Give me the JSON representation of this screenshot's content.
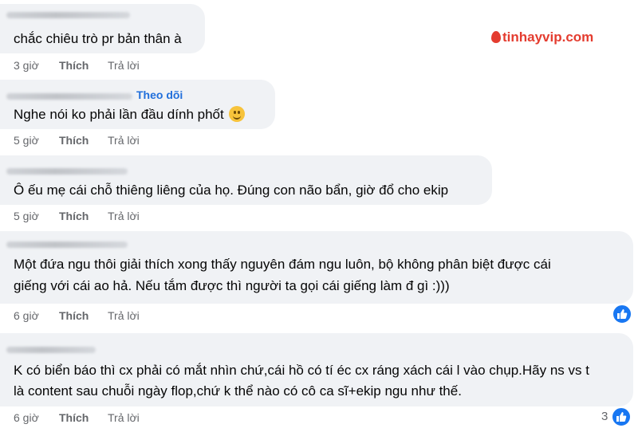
{
  "watermark": {
    "brand": "tinhayvip",
    "tld": ".com"
  },
  "comments": [
    {
      "text": "chắc chiêu trò pr bản thân à",
      "time": "3 giờ",
      "like": "Thích",
      "reply": "Trả lời"
    },
    {
      "follow": "Theo dõi",
      "text": "Nghe nói ko phải lần đầu dính phốt",
      "time": "5 giờ",
      "like": "Thích",
      "reply": "Trả lời"
    },
    {
      "text": "Ô ếu mẹ cái chỗ thiêng liêng của họ. Đúng con não bẩn, giờ đổ cho ekip",
      "time": "5 giờ",
      "like": "Thích",
      "reply": "Trả lời"
    },
    {
      "lines": [
        "Một đứa ngu thôi giải thích xong thấy nguyên đám ngu luôn, bộ không phân biệt được cái",
        "giếng với cái ao hả. Nếu tắm được thì người ta gọi cái giếng làm đ gì :)))"
      ],
      "time": "6 giờ",
      "like": "Thích",
      "reply": "Trả lời"
    },
    {
      "lines": [
        "K có biển báo thì cx phải có mắt nhìn chứ,cái hồ có tí éc cx ráng xách cái l vào chụp.Hãy ns vs t",
        "là content sau chuỗi ngày flop,chứ k thể nào có cô ca sĩ+ekip ngu như thế."
      ],
      "time": "6 giờ",
      "like": "Thích",
      "reply": "Trả lời",
      "reaction_count": "3"
    }
  ]
}
